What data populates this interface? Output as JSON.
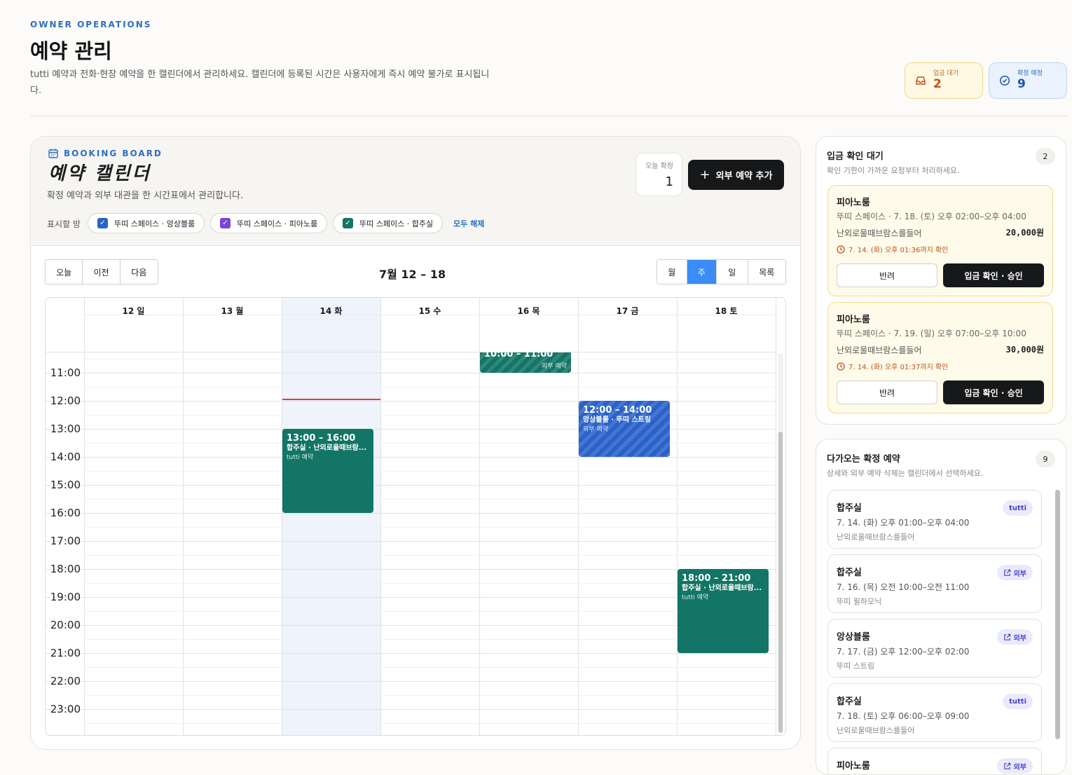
{
  "header": {
    "eyebrow": "OWNER OPERATIONS",
    "title": "예약 관리",
    "description": "tutti 예약과 전화·현장 예약을 한 캘린더에서 관리하세요. 캘린더에 등록된 시간은 사용자에게 즉시 예약 불가로 표시됩니다.",
    "stats": [
      {
        "label": "입금 대기",
        "value": "2",
        "icon": "inbox-icon"
      },
      {
        "label": "확정 예정",
        "value": "9",
        "icon": "check-circle-icon"
      }
    ]
  },
  "board": {
    "eyebrow": "BOOKING BOARD",
    "title": "예약 캘린더",
    "description": "확정 예약과 외부 대관을 한 시간표에서 관리합니다.",
    "today_label": "오늘 확정",
    "today_value": "1",
    "add_button": "외부 예약 추가",
    "filter_label": "표시할 방",
    "rooms": [
      {
        "label": "뚜띠 스페이스 · 앙상블룸",
        "color": "#2a62c9"
      },
      {
        "label": "뚜띠 스페이스 · 피아노룸",
        "color": "#7a45d6"
      },
      {
        "label": "뚜띠 스페이스 · 합주실",
        "color": "#127565"
      }
    ],
    "clear_label": "모두 해제"
  },
  "calendar": {
    "nav": [
      "오늘",
      "이전",
      "다음"
    ],
    "range": "7월 12 – 18",
    "views": [
      "월",
      "주",
      "일",
      "목록"
    ],
    "active_view": "주",
    "days": [
      "12 일",
      "13 월",
      "14 화",
      "15 수",
      "16 목",
      "17 금",
      "18 토"
    ],
    "today_index": 2,
    "partial_time": "10:00",
    "times": [
      "11:00",
      "12:00",
      "13:00",
      "14:00",
      "15:00",
      "16:00",
      "17:00",
      "18:00",
      "19:00",
      "20:00",
      "21:00",
      "22:00",
      "23:00"
    ],
    "events": [
      {
        "day": 4,
        "start": 10.0,
        "end": 11.0,
        "time": "10:00 – 11:00",
        "title": "",
        "kind": "외부 예약",
        "color": "#127565",
        "striped": true
      },
      {
        "day": 2,
        "start": 13.0,
        "end": 16.0,
        "time": "13:00 – 16:00",
        "title": "합주실 · 난외로울때브람...",
        "kind": "tutti 예약",
        "color": "#127565",
        "striped": false
      },
      {
        "day": 5,
        "start": 12.0,
        "end": 14.0,
        "time": "12:00 – 14:00",
        "title": "앙상블룸 · 뚜띠 스트링",
        "kind": "외부 예약",
        "color": "#2a62c9",
        "striped": true
      },
      {
        "day": 6,
        "start": 18.0,
        "end": 21.0,
        "time": "18:00 – 21:00",
        "title": "합주실 · 난외로울때브람...",
        "kind": "tutti 예약",
        "color": "#127565",
        "striped": false
      }
    ]
  },
  "pending": {
    "title": "입금 확인 대기",
    "subtitle": "확인 기한이 가까운 요청부터 처리하세요.",
    "count": "2",
    "items": [
      {
        "room": "피아노룸",
        "info": "뚜띠 스페이스 · 7. 18. (토) 오후 02:00–오후 04:00",
        "name": "난외로울때브람스를들어",
        "price": "20,000원",
        "deadline": "7. 14. (화) 오후 01:36까지 확인",
        "reject": "반려",
        "approve": "입금 확인 · 승인"
      },
      {
        "room": "피아노룸",
        "info": "뚜띠 스페이스 · 7. 19. (일) 오후 07:00–오후 10:00",
        "name": "난외로울때브람스를들어",
        "price": "30,000원",
        "deadline": "7. 14. (화) 오후 01:37까지 확인",
        "reject": "반려",
        "approve": "입금 확인 · 승인"
      }
    ]
  },
  "upcoming": {
    "title": "다가오는 확정 예약",
    "subtitle": "상세와 외부 예약 삭제는 캘린더에서 선택하세요.",
    "count": "9",
    "items": [
      {
        "room": "합주실",
        "when": "7. 14. (화) 오후 01:00–오후 04:00",
        "who": "난외로울때브람스를들어",
        "badge": "tutti",
        "external": false
      },
      {
        "room": "합주실",
        "when": "7. 16. (목) 오전 10:00–오전 11:00",
        "who": "뚜띠 필하모닉",
        "badge": "외부",
        "external": true
      },
      {
        "room": "앙상블룸",
        "when": "7. 17. (금) 오후 12:00–오후 02:00",
        "who": "뚜띠 스트링",
        "badge": "외부",
        "external": true
      },
      {
        "room": "합주실",
        "when": "7. 18. (토) 오후 06:00–오후 09:00",
        "who": "난외로울때브람스를들어",
        "badge": "tutti",
        "external": false
      },
      {
        "room": "피아노룸",
        "when": "",
        "who": "",
        "badge": "외부",
        "external": true
      }
    ]
  }
}
